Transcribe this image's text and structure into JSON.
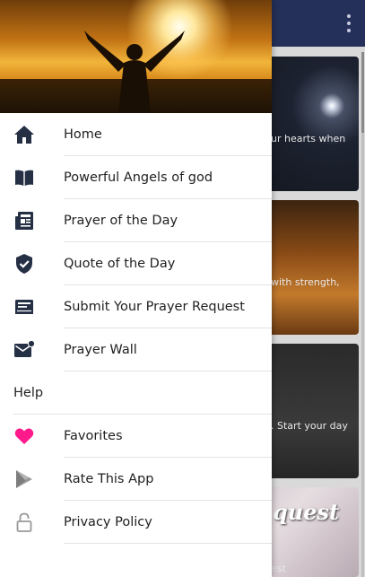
{
  "background_cards": [
    {
      "snippet": "ur hearts when"
    },
    {
      "snippet": "with strength,"
    },
    {
      "snippet": ". Start your day"
    },
    {
      "snippet": "est",
      "big_text": "quest"
    }
  ],
  "drawer": {
    "header_image": "man with raised arms at sunset",
    "items": [
      {
        "label": "Home",
        "icon": "home-icon"
      },
      {
        "label": "Powerful Angels of god",
        "icon": "book-icon"
      },
      {
        "label": "Prayer of the Day",
        "icon": "newspaper-icon"
      },
      {
        "label": "Quote of the Day",
        "icon": "shield-check-icon"
      },
      {
        "label": "Submit Your Prayer Request",
        "icon": "submit-form-icon"
      },
      {
        "label": "Prayer Wall",
        "icon": "mail-notification-icon"
      }
    ],
    "section_title": "Help",
    "help_items": [
      {
        "label": "Favorites",
        "icon": "heart-icon"
      },
      {
        "label": "Rate This App",
        "icon": "play-store-icon"
      },
      {
        "label": "Privacy Policy",
        "icon": "lock-icon"
      }
    ]
  },
  "colors": {
    "appbar": "#25305a",
    "heart": "#ff1a8c",
    "icon_dark": "#263045"
  }
}
